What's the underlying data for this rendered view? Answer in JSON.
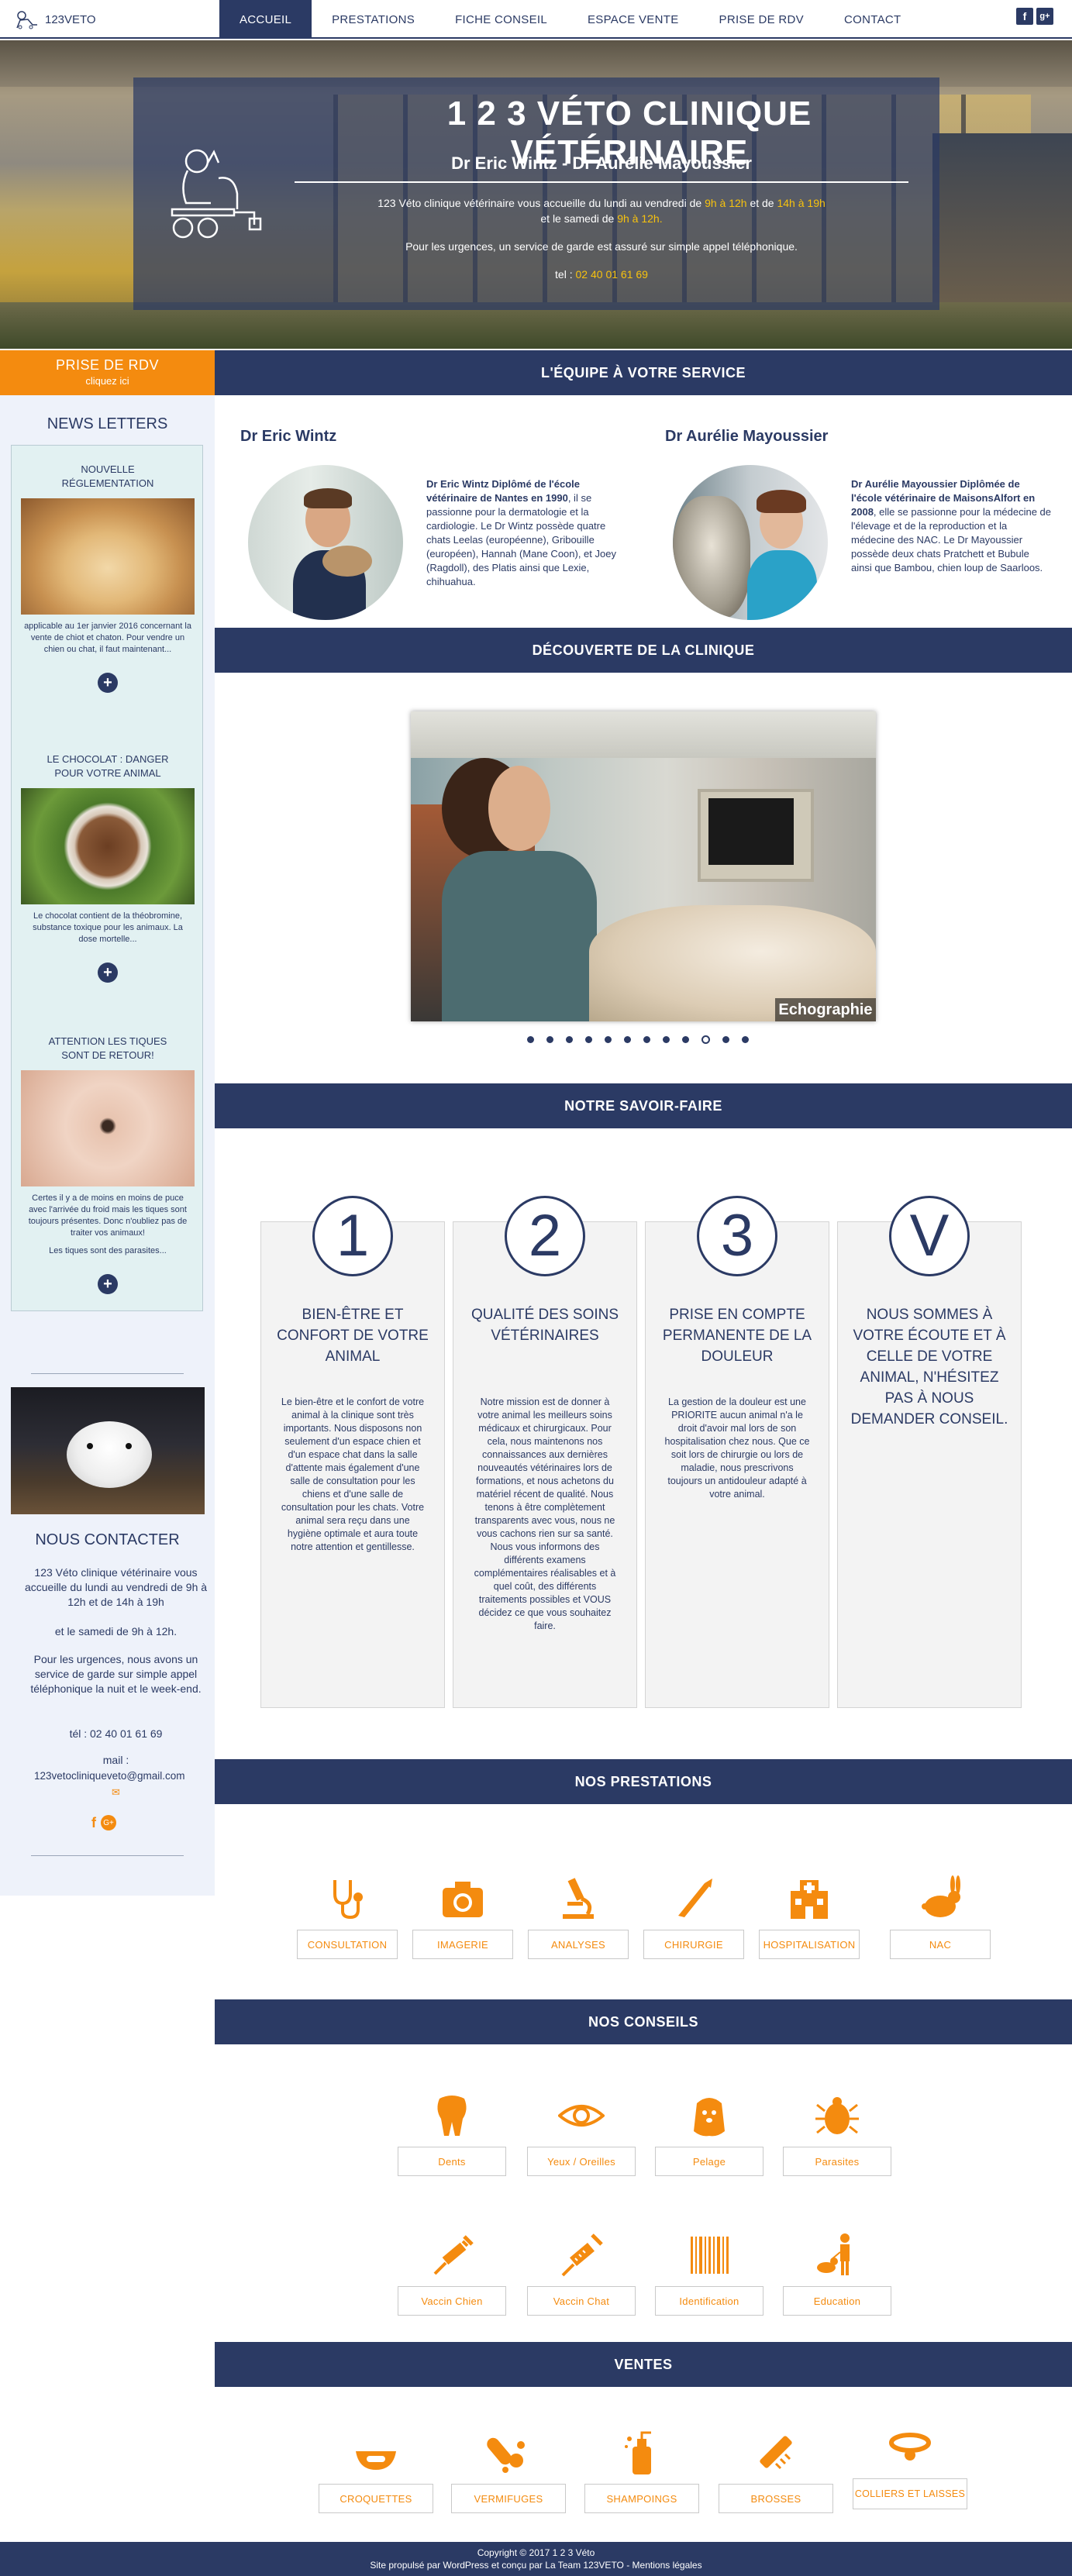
{
  "nav": {
    "logo_text": "123VETO",
    "items": [
      {
        "label": "ACCUEIL"
      },
      {
        "label": "PRESTATIONS"
      },
      {
        "label": "FICHE CONSEIL"
      },
      {
        "label": "ESPACE VENTE"
      },
      {
        "label": "PRISE DE RDV"
      },
      {
        "label": "CONTACT"
      }
    ],
    "social": [
      {
        "icon": "facebook-icon",
        "glyph": "f"
      },
      {
        "icon": "google-plus-icon",
        "glyph": "g+"
      }
    ]
  },
  "hero": {
    "title": "1 2 3 VÉTO CLINIQUE VÉTÉRINAIRE",
    "subtitle": "Dr Eric Wintz - Dr Aurélie Mayoussier",
    "hours_a": "123 Véto clinique vétérinaire vous accueille du lundi au vendredi de ",
    "hours_b": "9h à 12h",
    "hours_c": " et de ",
    "hours_d": "14h à 19h",
    "hours_e": "et le samedi de ",
    "hours_f": "9h à 12h.",
    "urgences": "Pour les urgences, un service de garde est assuré sur simple appel téléphonique.",
    "tel_label": "tel : ",
    "tel": "02 40 01 61 69"
  },
  "sidebar": {
    "rdv_title": "PRISE DE RDV",
    "rdv_sub": "cliquez ici",
    "newsletters_title": "NEWS LETTERS",
    "news": [
      {
        "title": "NOUVELLE RÉGLEMENTATION",
        "text": "applicable au 1er janvier 2016 concernant la vente de chiot et chaton. Pour vendre un chien ou chat, il faut maintenant...",
        "more": "+"
      },
      {
        "title": "LE CHOCOLAT : DANGER POUR VOTRE ANIMAL",
        "text": "Le chocolat contient de la théobromine, substance toxique pour les animaux. La dose mortelle...",
        "more": "+"
      },
      {
        "title": "ATTENTION LES TIQUES SONT DE RETOUR!",
        "text": "Certes il y a de moins en moins de puce avec l'arrivée du froid mais les tiques sont toujours présentes. Donc n'oubliez pas de traiter vos animaux!",
        "text2": "Les tiques sont des parasites...",
        "more": "+"
      }
    ],
    "contact_title": "NOUS CONTACTER",
    "contact_hours": "123 Véto clinique vétérinaire vous accueille du lundi au vendredi de 9h à 12h et de 14h à 19h",
    "contact_hours2": "et le samedi de 9h à 12h.",
    "contact_urgences": "Pour les urgences, nous avons un service de garde sur simple appel téléphonique la nuit et le week-end.",
    "contact_tel": "tél : 02 40 01 61 69",
    "contact_mail_label": "mail :",
    "contact_mail": "123vetocliniqueveto@gmail.com"
  },
  "team": {
    "band": "L'ÉQUIPE À VOTRE SERVICE",
    "doctors": [
      {
        "name": "Dr Eric Wintz",
        "bold": "Dr Eric Wintz Diplômé de l'école vétérinaire de Nantes en 1990",
        "text": ", il se passionne pour la dermatologie et la cardiologie. Le Dr Wintz possède quatre chats Leelas (européenne), Gribouille (européen), Hannah (Mane Coon), et Joey (Ragdoll), des Platis ainsi que Lexie, chihuahua."
      },
      {
        "name": "Dr Aurélie Mayoussier",
        "bold": "Dr Aurélie Mayoussier Diplômée de l'école vétérinaire de MaisonsAlfort en 2008",
        "text": ", elle se passionne pour la médecine de l'élevage et de la reproduction et la médecine des NAC. Le Dr Mayoussier possède deux chats Pratchett et Bubule ainsi que Bambou, chien loup de Saarloos."
      }
    ]
  },
  "clinic": {
    "band": "DÉCOUVERTE DE LA CLINIQUE",
    "caption": "Echographie",
    "dots": 12,
    "active_dot": 9
  },
  "savoir": {
    "band": "NOTRE SAVOIR-FAIRE",
    "cards": [
      {
        "num": "1",
        "title": "BIEN-ÊTRE ET CONFORT DE VOTRE ANIMAL",
        "text": "Le bien-être et le confort de votre animal à la clinique sont très importants. Nous disposons non seulement d'un espace chien et d'un espace chat dans la salle d'attente mais également d'une salle de consultation pour les chiens et d'une salle de consultation pour les chats. Votre animal sera reçu dans une hygiène optimale et aura toute notre attention et gentillesse."
      },
      {
        "num": "2",
        "title": "QUALITÉ DES SOINS VÉTÉRINAIRES",
        "text": "Notre mission est de donner à votre animal les meilleurs soins médicaux et chirurgicaux. Pour cela, nous maintenons nos connaissances aux dernières nouveautés vétérinaires lors de formations, et nous achetons du matériel récent de qualité. Nous tenons à être complètement transparents avec vous, nous ne vous cachons rien sur sa santé. Nous vous informons des différents examens complémentaires réalisables et à quel coût, des différents traitements possibles et VOUS décidez ce que vous souhaitez faire."
      },
      {
        "num": "3",
        "title": "PRISE EN COMPTE PERMANENTE DE LA DOULEUR",
        "text": "La gestion de la douleur est une PRIORITE aucun animal n'a le droit d'avoir mal lors de son hospitalisation chez nous. Que ce soit lors de chirurgie ou lors de maladie, nous prescrivons toujours un antidouleur adapté à votre animal."
      },
      {
        "num": "V",
        "title": "NOUS SOMMES À VOTRE ÉCOUTE ET À CELLE DE VOTRE ANIMAL, N'HÉSITEZ PAS À NOUS DEMANDER CONSEIL.",
        "text": ""
      }
    ]
  },
  "prestations": {
    "band": "NOS PRESTATIONS",
    "items": [
      {
        "label": "CONSULTATION",
        "icon": "stethoscope-icon"
      },
      {
        "label": "IMAGERIE",
        "icon": "camera-icon"
      },
      {
        "label": "ANALYSES",
        "icon": "microscope-icon"
      },
      {
        "label": "CHIRURGIE",
        "icon": "scalpel-icon"
      },
      {
        "label": "HOSPITALISATION",
        "icon": "hospital-icon"
      },
      {
        "label": "NAC",
        "icon": "rabbit-icon"
      }
    ]
  },
  "conseils": {
    "band": "NOS CONSEILS",
    "items": [
      {
        "label": "Dents",
        "icon": "tooth-icon"
      },
      {
        "label": "Yeux / Oreilles",
        "icon": "eye-icon"
      },
      {
        "label": "Pelage",
        "icon": "dog-fur-icon"
      },
      {
        "label": "Parasites",
        "icon": "tick-icon"
      },
      {
        "label": "Vaccin Chien",
        "icon": "syringe-icon"
      },
      {
        "label": "Vaccin Chat",
        "icon": "syringe-icon"
      },
      {
        "label": "Identification",
        "icon": "barcode-icon"
      },
      {
        "label": "Education",
        "icon": "training-icon"
      }
    ]
  },
  "ventes": {
    "band": "VENTES",
    "items": [
      {
        "label": "CROQUETTES",
        "icon": "food-bowl-icon"
      },
      {
        "label": "VERMIFUGES",
        "icon": "pills-icon"
      },
      {
        "label": "SHAMPOINGS",
        "icon": "shampoo-icon"
      },
      {
        "label": "BROSSES",
        "icon": "brush-icon"
      },
      {
        "label": "COLLIERS ET LAISSES",
        "icon": "collar-icon"
      }
    ]
  },
  "footer": {
    "copyright": "Copyright © 2017 1 2 3 Véto",
    "credits": "Site propulsé par WordPress et conçu par La Team 123VETO  - Mentions légales"
  },
  "colors": {
    "navy": "#2b3a64",
    "orange": "#f48b0f",
    "yellow": "#f7c20e"
  }
}
